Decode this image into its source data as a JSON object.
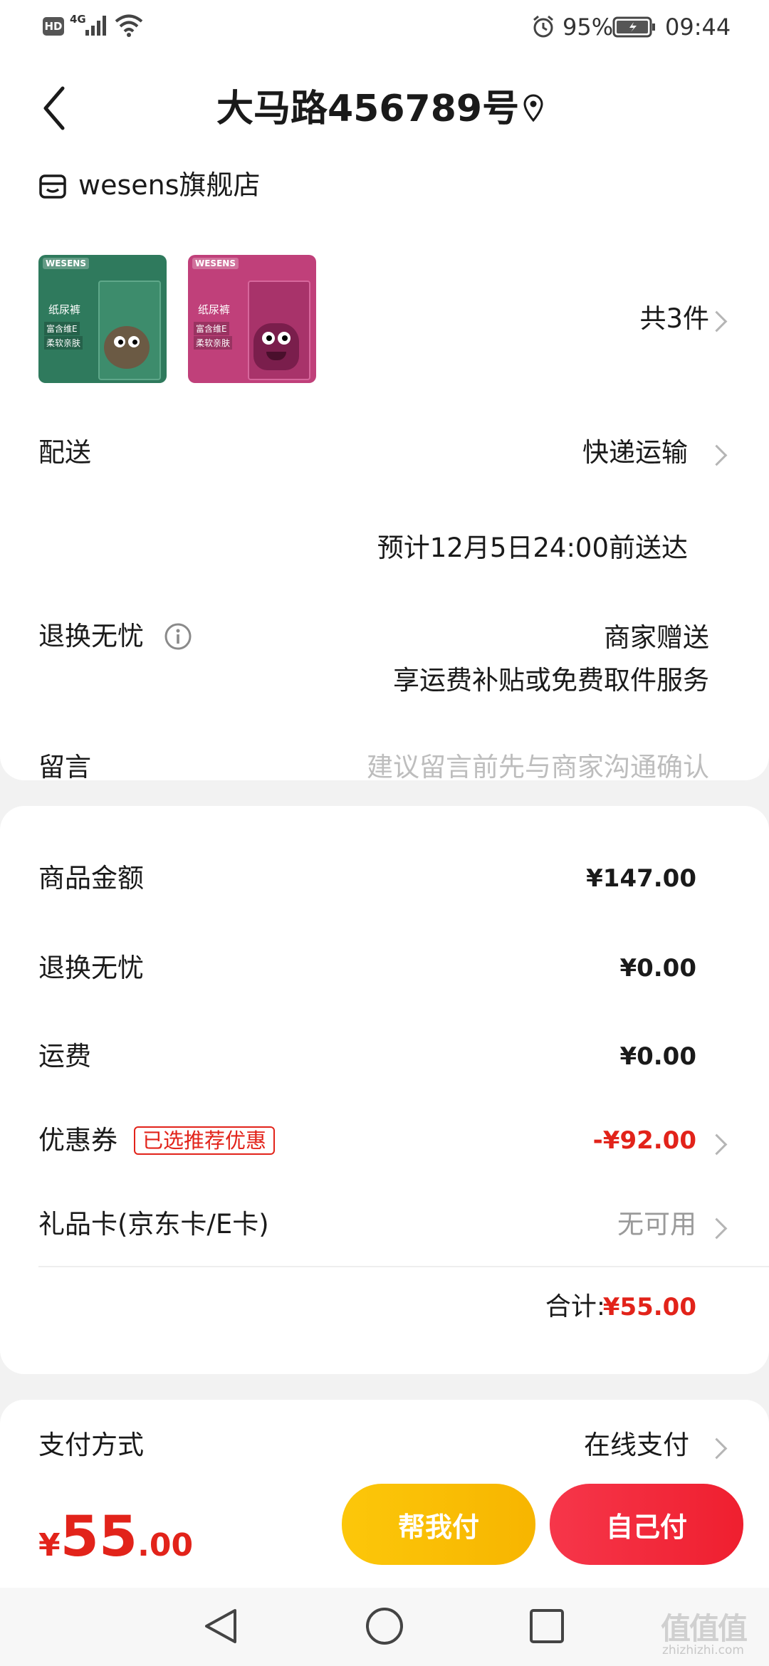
{
  "status_bar": {
    "left_badges": [
      "HD",
      "4G"
    ],
    "battery": "95%",
    "time": "09:44"
  },
  "header": {
    "title": "大马路456789号"
  },
  "shop": {
    "name": "wesens旗舰店",
    "products": [
      {
        "brand": "WESENS",
        "tag": "纸尿裤",
        "line1": "富含维E",
        "line2": "柔软亲肤",
        "color": "#2f7a5d"
      },
      {
        "brand": "WESENS",
        "tag": "纸尿裤",
        "line1": "富含维E",
        "line2": "柔软亲肤",
        "color": "#c0407a"
      }
    ],
    "count_label": "共3件"
  },
  "delivery": {
    "label": "配送",
    "method": "快递运输",
    "eta": "预计12月5日24:00前送达"
  },
  "return_service": {
    "label": "退换无忧",
    "value": "商家赠送",
    "detail": "享运费补贴或免费取件服务"
  },
  "message": {
    "label": "留言",
    "placeholder": "建议留言前先与商家沟通确认"
  },
  "summary": {
    "goods_label": "商品金额",
    "goods_value": "¥147.00",
    "return_label": "退换无忧",
    "return_value": "¥0.00",
    "shipping_label": "运费",
    "shipping_value": "¥0.00",
    "coupon_label": "优惠券",
    "coupon_badge": "已选推荐优惠",
    "coupon_value": "-¥92.00",
    "giftcard_label": "礼品卡(京东卡/E卡)",
    "giftcard_value": "无可用",
    "total_label": "合计:",
    "total_value": "¥55.00"
  },
  "payment": {
    "label": "支付方式",
    "value": "在线支付"
  },
  "bottom_bar": {
    "currency": "¥",
    "amount_int": "55",
    "amount_dec": ".00",
    "help_pay_label": "帮我付",
    "self_pay_label": "自己付"
  },
  "watermark": {
    "text": "值值值",
    "site": "zhizhizhi.com"
  },
  "colors": {
    "accent_red": "#e2231a",
    "help_pay": "#f9b800",
    "self_pay": "#f0283c"
  }
}
